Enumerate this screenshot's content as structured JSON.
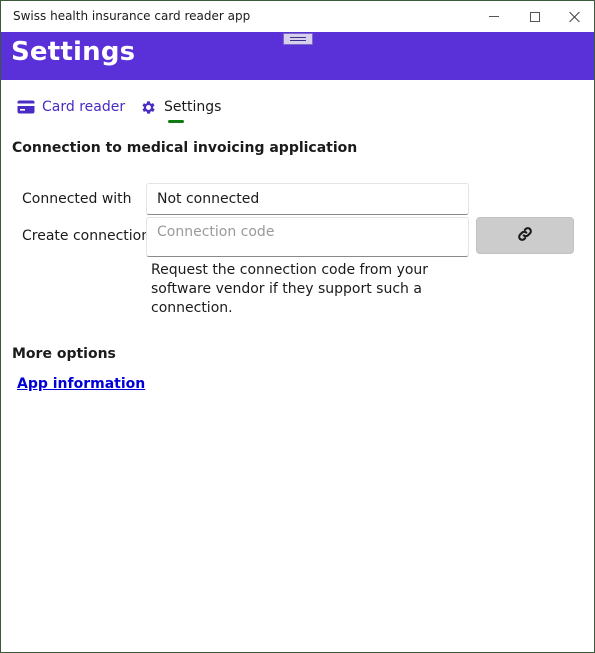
{
  "window": {
    "title": "Swiss health insurance card reader app"
  },
  "header": {
    "title": "Settings",
    "color": "#5a30d9"
  },
  "nav": {
    "tabs": [
      {
        "label": "Card reader",
        "icon": "credit-card-icon",
        "selected": false
      },
      {
        "label": "Settings",
        "icon": "gear-icon",
        "selected": true
      }
    ],
    "accent": "#4a2bc4",
    "indicator_color": "#107c10"
  },
  "connection": {
    "title": "Connection to medical invoicing application",
    "connected_label": "Connected with",
    "connected_value": "Not connected",
    "create_label": "Create connection",
    "code_placeholder": "Connection code",
    "code_value": "",
    "connect_button_icon": "link-icon",
    "hint": "Request the connection code from your software vendor if they support such a connection."
  },
  "more_options": {
    "title": "More options",
    "app_info_link": "App information"
  }
}
